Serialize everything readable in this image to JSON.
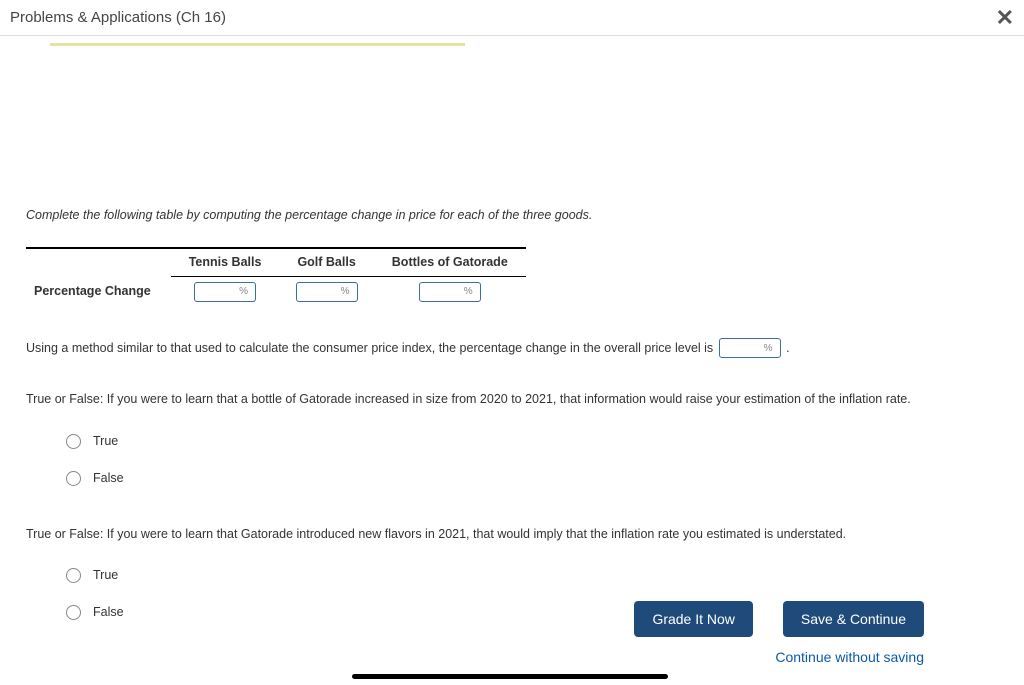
{
  "header": {
    "title": "Problems & Applications (Ch 16)"
  },
  "instruction": "Complete the following table by computing the percentage change in price for each of the three goods.",
  "table": {
    "headers": [
      "Tennis Balls",
      "Golf Balls",
      "Bottles of Gatorade"
    ],
    "row_label": "Percentage Change",
    "unit": "%"
  },
  "overall_prefix": "Using a method similar to that used to calculate the consumer price index, the percentage change in the overall price level is",
  "overall_suffix": ".",
  "q1": {
    "text": "True or False: If you were to learn that a bottle of Gatorade increased in size from 2020 to 2021, that information would raise your estimation of the inflation rate.",
    "options": [
      "True",
      "False"
    ]
  },
  "q2": {
    "text": "True or False: If you were to learn that Gatorade introduced new flavors in 2021, that would imply that the inflation rate you estimated is understated.",
    "options": [
      "True",
      "False"
    ]
  },
  "buttons": {
    "grade": "Grade It Now",
    "save": "Save & Continue",
    "continue": "Continue without saving"
  }
}
